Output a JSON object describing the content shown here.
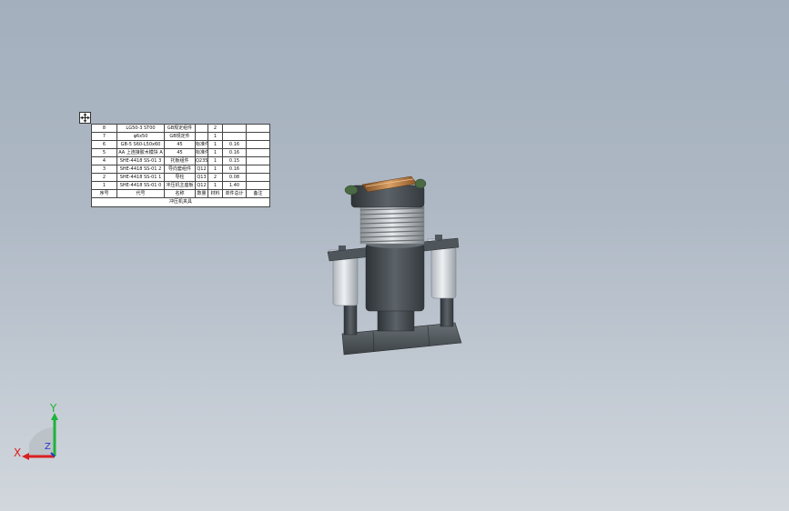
{
  "bom": {
    "header": [
      "序号",
      "代号",
      "名称",
      "数量",
      "材料",
      "单件总计",
      "备注"
    ],
    "rows": [
      [
        "8",
        "LG50-3 ST00",
        "GB规定组件",
        "",
        "2",
        "",
        ""
      ],
      [
        "7",
        "φ6x50",
        "GB规定件",
        "",
        "1",
        "",
        ""
      ],
      [
        "6",
        "GB-5 S60-L50x60",
        "45",
        "标准件",
        "1",
        "0.16",
        ""
      ],
      [
        "5",
        "AA 上连接胶木模块 A",
        "45",
        "标准件",
        "1",
        "0.16",
        ""
      ],
      [
        "4",
        "SHE-4418 SS-01 3",
        "托板组件",
        "Q235-A",
        "1",
        "0.15",
        ""
      ],
      [
        "3",
        "SHE-4418 SS-01 2",
        "导向套组件",
        "Q12",
        "1",
        "0.16",
        ""
      ],
      [
        "2",
        "SHE-4418 SS-01 1",
        "导柱",
        "Q13",
        "2",
        "0.08",
        ""
      ],
      [
        "1",
        "SHE-4418 SS-01 0",
        "冲压机主座板",
        "Q12",
        "1",
        "1.40",
        ""
      ]
    ],
    "title": "冲压机夹具"
  },
  "triad": {
    "x_label": "X",
    "y_label": "Y",
    "z_label": "Z"
  },
  "colors": {
    "x_axis": "#d92020",
    "y_axis": "#1db33a",
    "z_axis": "#2a36d0",
    "metal_dark": "#3e4448",
    "metal_mid": "#5a6167",
    "metal_light": "#d3d8dd",
    "spring": "#c8cccf",
    "copper": "#b8783a",
    "green_knob": "#4a6a44"
  }
}
